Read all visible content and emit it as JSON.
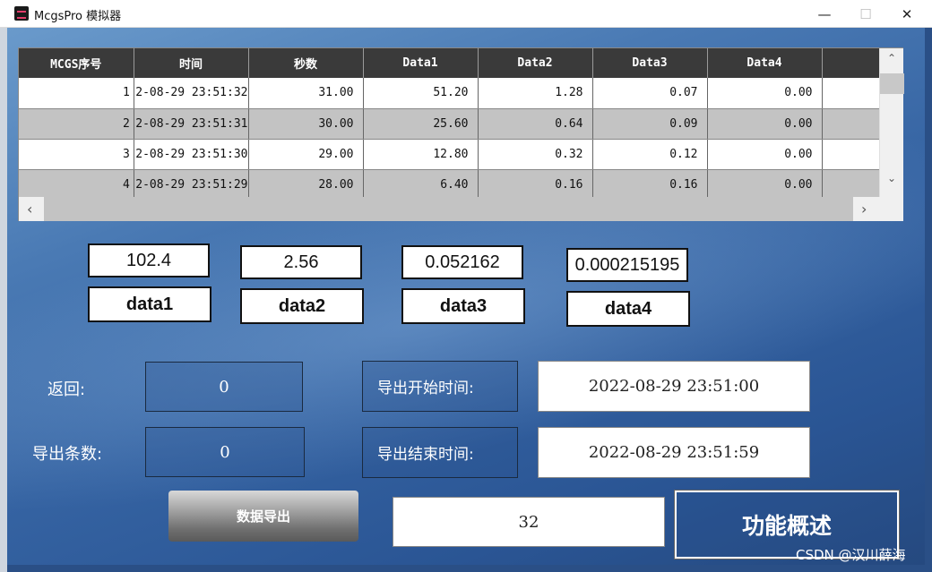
{
  "window": {
    "title": "McgsPro 模拟器",
    "minimize_glyph": "—",
    "maximize_glyph": "☐",
    "close_glyph": "✕"
  },
  "table": {
    "columns": [
      "MCGS序号",
      "时间",
      "秒数",
      "Data1",
      "Data2",
      "Data3",
      "Data4"
    ],
    "rows": [
      {
        "seq": "1",
        "time": "2-08-29 23:51:32",
        "sec": "31.00",
        "d1": "51.20",
        "d2": "1.28",
        "d3": "0.07",
        "d4": "0.00"
      },
      {
        "seq": "2",
        "time": "2-08-29 23:51:31",
        "sec": "30.00",
        "d1": "25.60",
        "d2": "0.64",
        "d3": "0.09",
        "d4": "0.00"
      },
      {
        "seq": "3",
        "time": "2-08-29 23:51:30",
        "sec": "29.00",
        "d1": "12.80",
        "d2": "0.32",
        "d3": "0.12",
        "d4": "0.00"
      },
      {
        "seq": "4",
        "time": "2-08-29 23:51:29",
        "sec": "28.00",
        "d1": "6.40",
        "d2": "0.16",
        "d3": "0.16",
        "d4": "0.00"
      }
    ],
    "scroll_up": "⌃",
    "scroll_down": "⌄",
    "scroll_left": "‹",
    "scroll_right": "›"
  },
  "values": [
    {
      "value": "102.4",
      "label": "data1"
    },
    {
      "value": "2.56",
      "label": "data2"
    },
    {
      "value": "0.052162",
      "label": "data3"
    },
    {
      "value": "0.000215195",
      "label": "data4"
    }
  ],
  "form": {
    "return_label": "返回:",
    "return_value": "0",
    "count_label": "导出条数:",
    "count_value": "0",
    "start_label": "导出开始时间:",
    "start_value": "2022-08-29 23:51:00",
    "end_label": "导出结束时间:",
    "end_value": "2022-08-29 23:51:59",
    "export_button": "数据导出",
    "number_value": "32",
    "overview_button": "功能概述"
  },
  "watermark": "CSDN @汉川薛海"
}
